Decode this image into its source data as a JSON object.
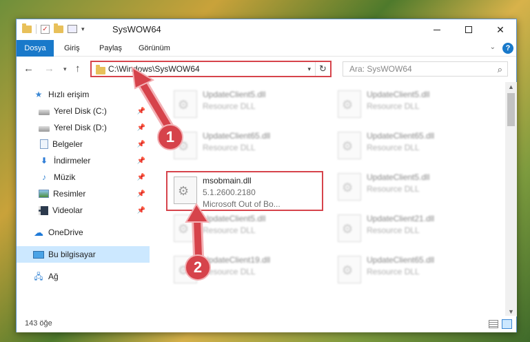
{
  "window": {
    "title": "SysWOW64"
  },
  "ribbon": {
    "tabs": [
      "Dosya",
      "Giriş",
      "Paylaş",
      "Görünüm"
    ]
  },
  "address": {
    "path": "C:\\Windows\\SysWOW64"
  },
  "search": {
    "placeholder": "Ara: SysWOW64"
  },
  "sidebar": {
    "items": [
      {
        "label": "Hızlı erişim",
        "icon": "star-icon"
      },
      {
        "label": "Yerel Disk (C:)",
        "icon": "drive-icon"
      },
      {
        "label": "Yerel Disk (D:)",
        "icon": "drive-icon"
      },
      {
        "label": "Belgeler",
        "icon": "documents-icon"
      },
      {
        "label": "İndirmeler",
        "icon": "downloads-icon"
      },
      {
        "label": "Müzik",
        "icon": "music-icon"
      },
      {
        "label": "Resimler",
        "icon": "pictures-icon"
      },
      {
        "label": "Videolar",
        "icon": "videos-icon"
      },
      {
        "label": "OneDrive",
        "icon": "onedrive-icon"
      },
      {
        "label": "Bu bilgisayar",
        "icon": "this-pc-icon"
      },
      {
        "label": "Ağ",
        "icon": "network-icon"
      }
    ]
  },
  "files": [
    {
      "name": "UpdateClient5.dll",
      "line2": "Resource DLL"
    },
    {
      "name": "UpdateClient5.dll",
      "line2": "Resource DLL"
    },
    {
      "name": "UpdateClient65.dll",
      "line2": "Resource DLL"
    },
    {
      "name": "UpdateClient65.dll",
      "line2": "Resource DLL"
    },
    {
      "name": "msobmain.dll",
      "line2": "5.1.2600.2180",
      "line3": "Microsoft Out of Bo..."
    },
    {
      "name": "UpdateClient5.dll",
      "line2": "Resource DLL"
    },
    {
      "name": "UpdateClient5.dll",
      "line2": "Resource DLL"
    },
    {
      "name": "UpdateClient21.dll",
      "line2": "Resource DLL"
    },
    {
      "name": "UpdateClient19.dll",
      "line2": "Resource DLL"
    },
    {
      "name": "UpdateClient65.dll",
      "line2": "Resource DLL"
    }
  ],
  "status": {
    "count": "143 öğe"
  },
  "annotations": {
    "step1": "1",
    "step2": "2"
  },
  "colors": {
    "accent": "#1979ca",
    "highlight": "#d6434b",
    "selected": "#cce8ff"
  }
}
